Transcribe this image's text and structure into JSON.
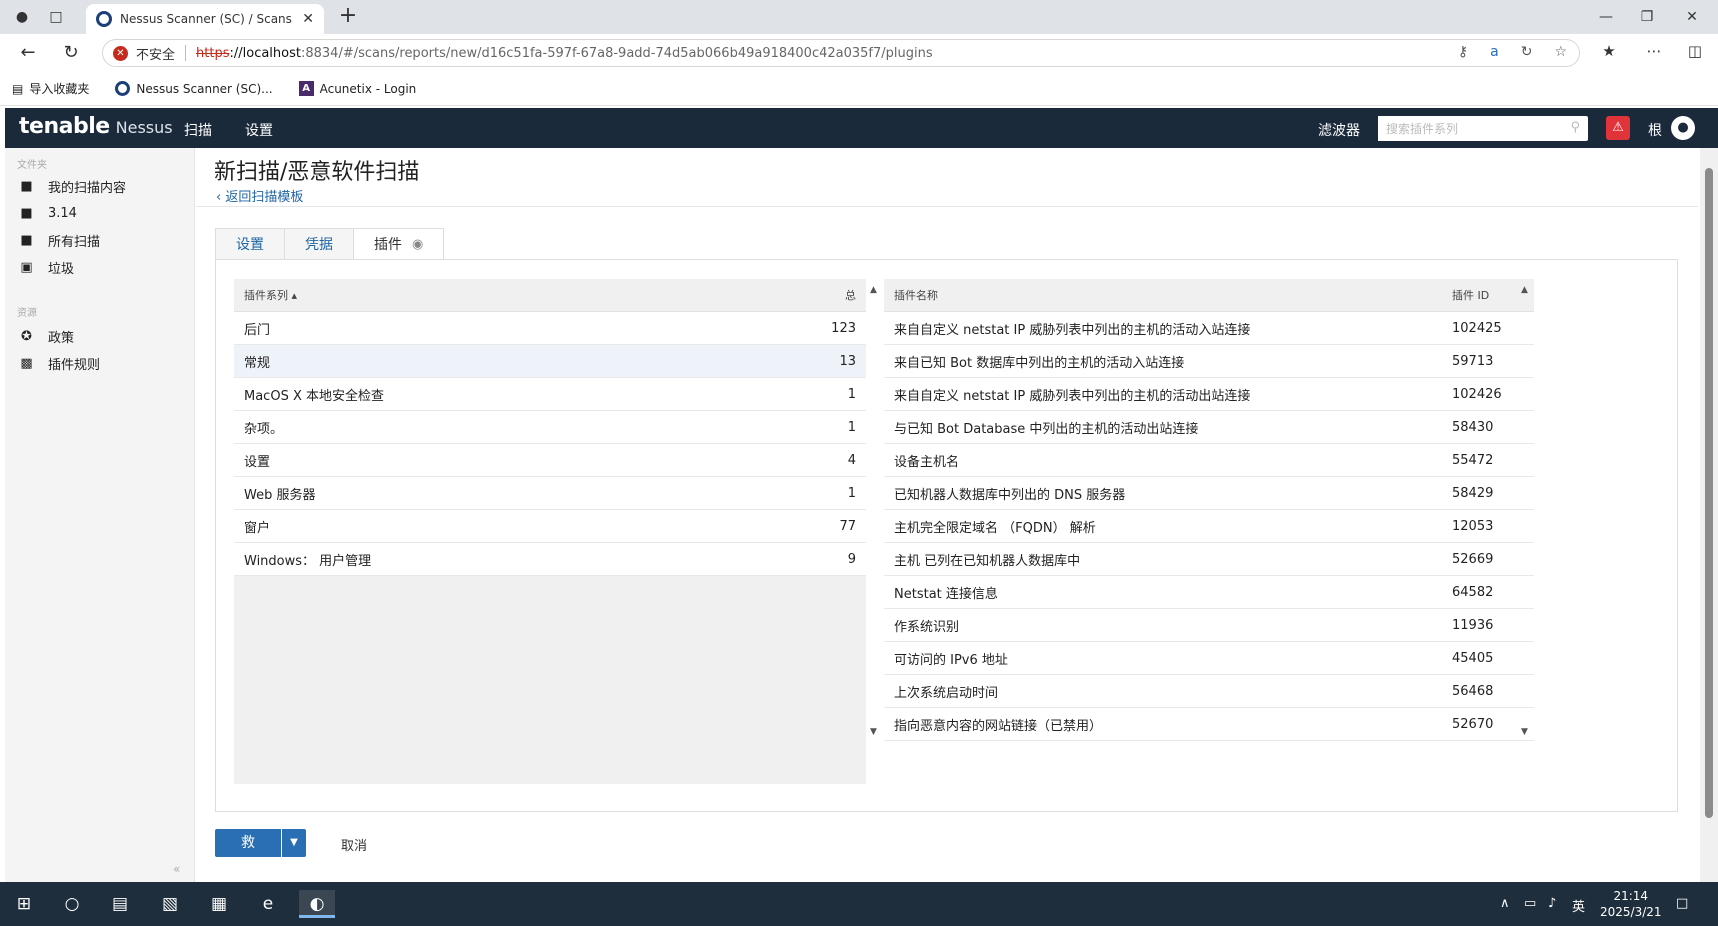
{
  "browser": {
    "tab_title": "Nessus Scanner (SC) / Scans / Edit",
    "insecure_label": "不安全",
    "url_scheme": "https",
    "url_host": "://localhost",
    "url_path": ":8834/#/scans/reports/new/d16c51fa-597f-67a8-9add-74d5ab066b49a918400c42a035f7/plugins",
    "bookmarks": [
      "导入收藏夹",
      "Nessus Scanner (SC)...",
      "Acunetix - Login"
    ]
  },
  "app": {
    "logo": "tenable",
    "product": "Nessus",
    "nav": [
      "扫描",
      "设置"
    ],
    "filter_label": "滤波器",
    "search_placeholder": "搜索插件系列",
    "user": "根"
  },
  "sidebar": {
    "folders_title": "文件夹",
    "folders": [
      {
        "label": "我的扫描内容",
        "icon": "folder-icon"
      },
      {
        "label": "3.14",
        "icon": "folder-icon"
      },
      {
        "label": "所有扫描",
        "icon": "folder-icon"
      },
      {
        "label": "垃圾",
        "icon": "trash-icon"
      }
    ],
    "resources_title": "资源",
    "resources": [
      {
        "label": "政策",
        "icon": "policy-icon"
      },
      {
        "label": "插件规则",
        "icon": "plugin-rules-icon"
      }
    ]
  },
  "page": {
    "title": "新扫描/恶意软件扫描",
    "back_link": "返回扫描模板",
    "tabs": [
      "设置",
      "凭据",
      "插件"
    ]
  },
  "families": {
    "header_family": "插件系列",
    "header_total": "总",
    "rows": [
      {
        "name": "后门",
        "total": "123"
      },
      {
        "name": "常规",
        "total": "13"
      },
      {
        "name": "MacOS X 本地安全检查",
        "total": "1"
      },
      {
        "name": "杂项。",
        "total": "1"
      },
      {
        "name": "设置",
        "total": "4"
      },
      {
        "name": "Web 服务器",
        "total": "1"
      },
      {
        "name": "窗户",
        "total": "77"
      },
      {
        "name": "Windows： 用户管理",
        "total": "9"
      }
    ]
  },
  "plugins": {
    "header_name": "插件名称",
    "header_id": "插件 ID",
    "rows": [
      {
        "name": "来自自定义 netstat IP 威胁列表中列出的主机的活动入站连接",
        "id": "102425"
      },
      {
        "name": "来自已知 Bot 数据库中列出的主机的活动入站连接",
        "id": "59713"
      },
      {
        "name": "来自自定义 netstat IP 威胁列表中列出的主机的活动出站连接",
        "id": "102426"
      },
      {
        "name": "与已知 Bot Database 中列出的主机的活动出站连接",
        "id": "58430"
      },
      {
        "name": "设备主机名",
        "id": "55472"
      },
      {
        "name": "已知机器人数据库中列出的 DNS 服务器",
        "id": "58429"
      },
      {
        "name": "主机完全限定域名 （FQDN） 解析",
        "id": "12053"
      },
      {
        "name": "主机 已列在已知机器人数据库中",
        "id": "52669"
      },
      {
        "name": "Netstat 连接信息",
        "id": "64582"
      },
      {
        "name": "作系统识别",
        "id": "11936"
      },
      {
        "name": "可访问的 IPv6 地址",
        "id": "45405"
      },
      {
        "name": "上次系统启动时间",
        "id": "56468"
      },
      {
        "name": "指向恶意内容的网站链接（已禁用）",
        "id": "52670"
      }
    ]
  },
  "actions": {
    "save": "救",
    "cancel": "取消"
  },
  "taskbar": {
    "ime": "英",
    "time": "21:14",
    "date": "2025/3/21"
  }
}
